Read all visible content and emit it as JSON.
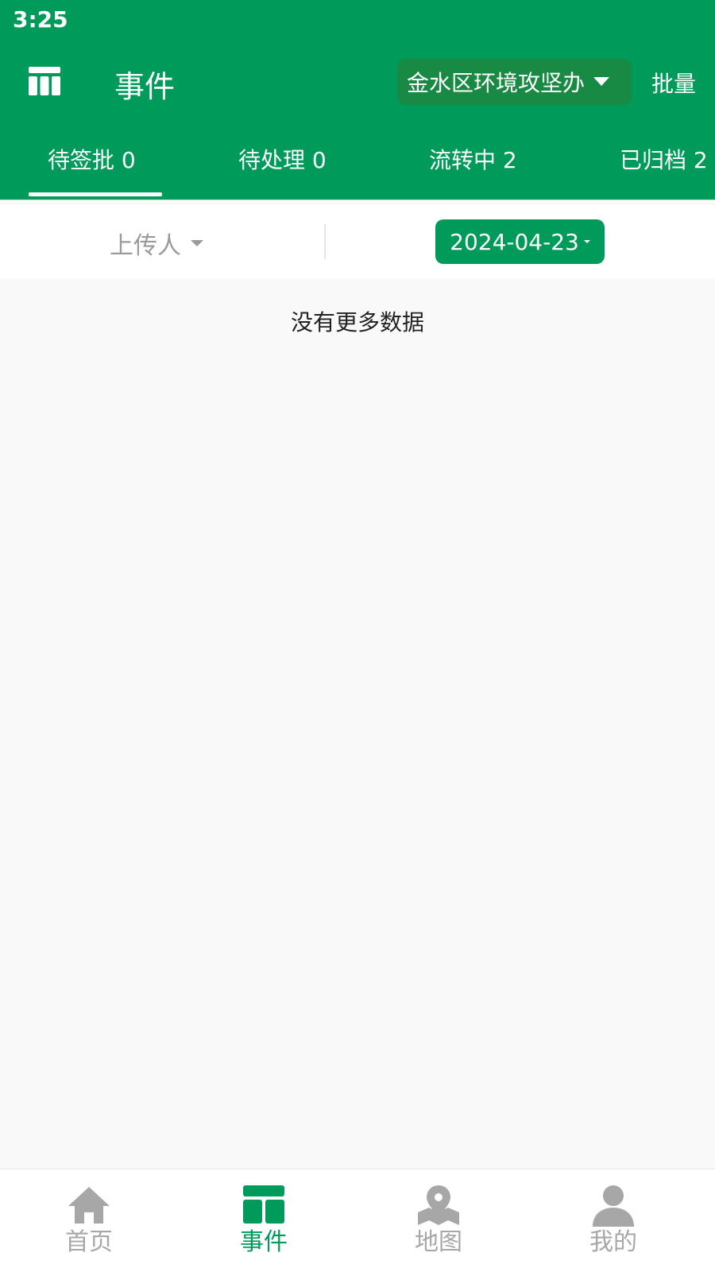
{
  "status_bar": {
    "time": "3:25"
  },
  "header": {
    "title": "事件",
    "org_select": "金水区环境攻坚办",
    "batch_label": "批量"
  },
  "tabs": [
    {
      "label": "待签批 0",
      "active": true
    },
    {
      "label": "待处理 0",
      "active": false
    },
    {
      "label": "流转中 2",
      "active": false
    },
    {
      "label": "已归档 2",
      "active": false
    }
  ],
  "filters": {
    "uploader_label": "上传人",
    "date_value": "2024-04-23"
  },
  "content": {
    "empty_text": "没有更多数据"
  },
  "bottom_nav": [
    {
      "label": "首页",
      "icon": "home-icon",
      "active": false
    },
    {
      "label": "事件",
      "icon": "event-grid-icon",
      "active": true
    },
    {
      "label": "地图",
      "icon": "map-pin-icon",
      "active": false
    },
    {
      "label": "我的",
      "icon": "user-icon",
      "active": false
    }
  ],
  "colors": {
    "brand_green": "#009b5a",
    "select_bg": "#188a44",
    "inactive_gray": "#a7a7a7"
  }
}
